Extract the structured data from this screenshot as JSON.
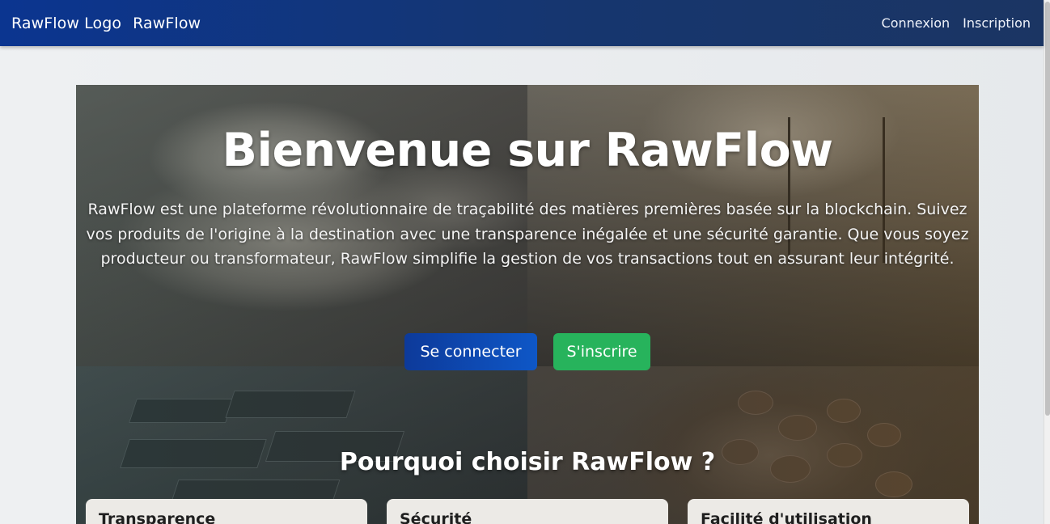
{
  "navbar": {
    "logo_alt": "RawFlow Logo",
    "brand": "RawFlow",
    "links": [
      "Connexion",
      "Inscription"
    ]
  },
  "hero": {
    "title": "Bienvenue sur RawFlow",
    "description": "RawFlow est une plateforme révolutionnaire de traçabilité des matières premières basée sur la blockchain. Suivez vos produits de l'origine à la destination avec une transparence inégalée et une sécurité garantie. Que vous soyez producteur ou transformateur, RawFlow simplifie la gestion de vos transactions tout en assurant leur intégrité.",
    "buttons": {
      "login": "Se connecter",
      "signup": "S'inscrire"
    }
  },
  "features": {
    "title": "Pourquoi choisir RawFlow ?",
    "cards": [
      {
        "title": "Transparence"
      },
      {
        "title": "Sécurité"
      },
      {
        "title": "Facilité d'utilisation"
      }
    ]
  },
  "colors": {
    "navbar": "#0b3590",
    "primary_button": "#0e57c7",
    "success_button": "#27b35c"
  }
}
